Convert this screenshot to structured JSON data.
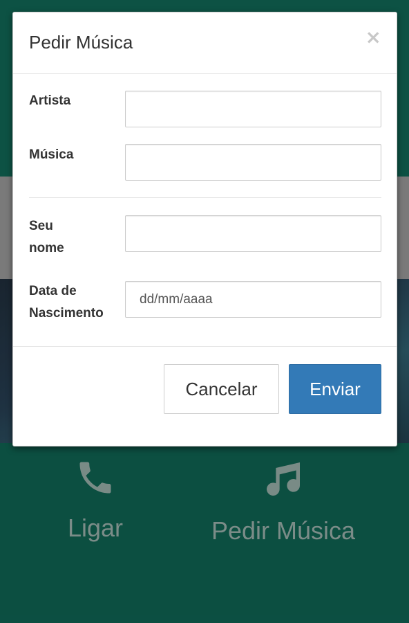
{
  "background": {
    "actions": [
      {
        "icon": "phone-icon",
        "label": "Ligar"
      },
      {
        "icon": "music-note-icon",
        "label": "Pedir Música"
      }
    ]
  },
  "modal": {
    "title": "Pedir Música",
    "close_symbol": "×",
    "fields": {
      "artist": {
        "label": "Artista",
        "value": "",
        "placeholder": ""
      },
      "song": {
        "label": "Música",
        "value": "",
        "placeholder": ""
      },
      "name": {
        "label_line1": "Seu",
        "label_line2": "nome",
        "value": "",
        "placeholder": ""
      },
      "birth": {
        "label_line1": "Data de",
        "label_line2": "Nascimento",
        "value": "",
        "placeholder": "dd/mm/aaaa"
      }
    },
    "buttons": {
      "cancel": "Cancelar",
      "send": "Enviar"
    }
  },
  "colors": {
    "primary": "#337ab7",
    "background_green": "#0e5a4b"
  }
}
